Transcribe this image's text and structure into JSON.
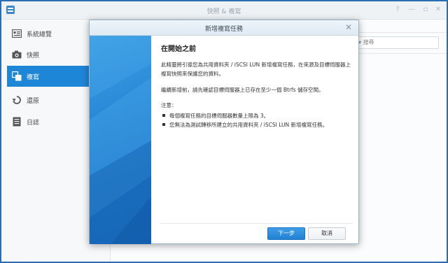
{
  "window": {
    "title": "快照 & 複寫",
    "controls": [
      "?",
      "—",
      "▫",
      "✕"
    ]
  },
  "sidebar": {
    "items": [
      {
        "label": "系統總覽",
        "icon": "overview-icon"
      },
      {
        "label": "快照",
        "icon": "camera-icon"
      },
      {
        "label": "複寫",
        "icon": "replication-icon",
        "active": true
      },
      {
        "label": "還原",
        "icon": "restore-icon"
      },
      {
        "label": "日誌",
        "icon": "log-icon"
      }
    ]
  },
  "main": {
    "search_placeholder": "搜尋"
  },
  "dialog": {
    "title": "新增複寫任務",
    "heading": "在開始之前",
    "intro": "此精靈將引導您為共用資料夾 / iSCSI LUN 新增複寫任務，在來源及目標伺服器上複寫快照來保護您的資料。",
    "requirement": "繼續新增前，請先確認目標伺服器上已存在至少一個 Btrfs 儲存空間。",
    "note_label": "注意：",
    "notes": [
      "每個複寫任務的目標伺服器數量上限為 3。",
      "您無法為測試轉移所建立的共用資料夾 / iSCSI LUN 新增複寫任務。"
    ],
    "next_label": "下一步",
    "cancel_label": "取消"
  },
  "colors": {
    "accent": "#1e86d6",
    "frame": "#2a6db1"
  }
}
